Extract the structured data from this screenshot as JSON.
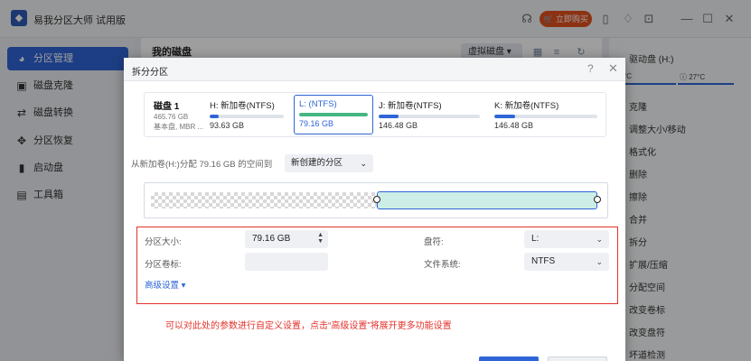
{
  "app": {
    "title": "易我分区大师 试用版",
    "buy_label": "立即购买"
  },
  "sidebar": {
    "items": [
      {
        "icon": "pie-chart-icon",
        "glyph": "◕",
        "label": "分区管理",
        "active": true
      },
      {
        "icon": "disk-clone-icon",
        "glyph": "▣",
        "label": "磁盘克隆",
        "active": false
      },
      {
        "icon": "disk-convert-icon",
        "glyph": "⇄",
        "label": "磁盘转换",
        "active": false
      },
      {
        "icon": "recovery-icon",
        "glyph": "✥",
        "label": "分区恢复",
        "active": false
      },
      {
        "icon": "boot-disk-icon",
        "glyph": "▮",
        "label": "启动盘",
        "active": false
      },
      {
        "icon": "toolbox-icon",
        "glyph": "▤",
        "label": "工具箱",
        "active": false
      }
    ]
  },
  "main": {
    "title": "我的磁盘",
    "view_mode_label": "虚拟磁盘"
  },
  "right_panel": {
    "drive_label": "驱动盘 (H:)",
    "temp_left": "°C",
    "temp_right": "27°C",
    "operations": [
      "克隆",
      "调整大小/移动",
      "格式化",
      "删除",
      "擦除",
      "合并",
      "拆分",
      "扩展/压缩",
      "分配空间",
      "改变卷标",
      "改变盘符",
      "坏道检测"
    ]
  },
  "dialog": {
    "title": "拆分分区",
    "disk": {
      "name": "磁盘 1",
      "size": "465.76 GB",
      "type": "基本盘, MBR ..."
    },
    "partitions": [
      {
        "name": "H: 新加卷(NTFS)",
        "size": "93.63 GB",
        "usage": 0.12,
        "selected": false
      },
      {
        "name": "L: (NTFS)",
        "size": "79.16 GB",
        "usage": 1.0,
        "selected": true
      },
      {
        "name": "J: 新加卷(NTFS)",
        "size": "146.48 GB",
        "usage": 0.2,
        "selected": false
      },
      {
        "name": "K: 新加卷(NTFS)",
        "size": "146.48 GB",
        "usage": 0.2,
        "selected": false
      }
    ],
    "allocate_text": "从新加卷(H:)分配 79.16 GB 的空间到",
    "allocate_target": "新创建的分区",
    "settings": {
      "size_label": "分区大小:",
      "size_value": "79.16 GB",
      "volume_label_label": "分区卷标:",
      "volume_label_value": "",
      "drive_letter_label": "盘符:",
      "drive_letter_value": "L:",
      "filesystem_label": "文件系统:",
      "filesystem_value": "NTFS",
      "advanced_label": "高级设置"
    },
    "annotation": "可以对此处的参数进行自定义设置，点击“高级设置”将展开更多功能设置"
  },
  "colors": {
    "accent": "#2f65d6",
    "buy": "#e2511f",
    "annotation_red": "#e2322b",
    "new_partition_fill": "#cdeee6"
  }
}
